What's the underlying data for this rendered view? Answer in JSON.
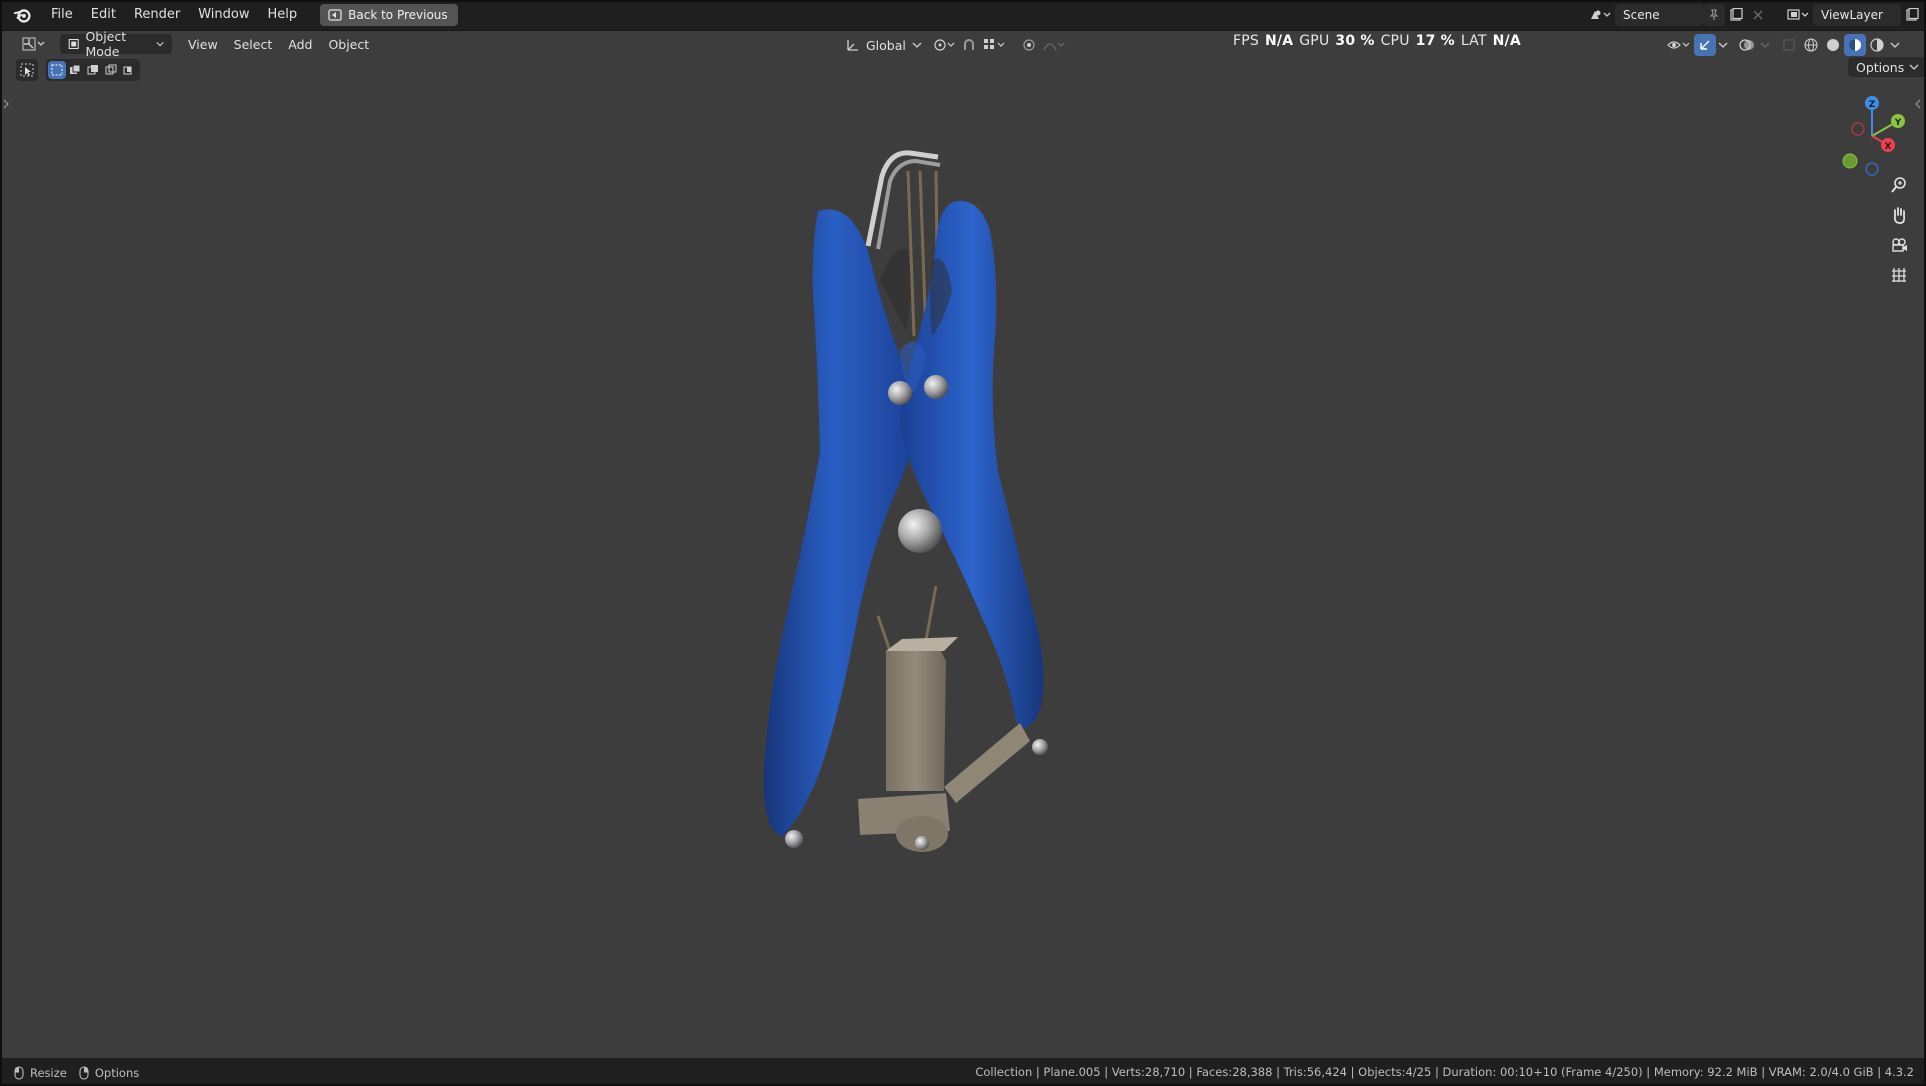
{
  "topbar": {
    "menu": [
      "File",
      "Edit",
      "Render",
      "Window",
      "Help"
    ],
    "back_button": "Back to Previous",
    "scene_name": "Scene",
    "view_layer": "ViewLayer"
  },
  "viewport_header": {
    "mode": "Object Mode",
    "menus": [
      "View",
      "Select",
      "Add",
      "Object"
    ],
    "orientation": "Global",
    "options": "Options"
  },
  "stats": {
    "fps_label": "FPS",
    "fps_value": "N/A",
    "gpu_label": "GPU",
    "gpu_value": "30 %",
    "cpu_label": "CPU",
    "cpu_value": "17 %",
    "lat_label": "LAT",
    "lat_value": "N/A"
  },
  "gizmo": {
    "z": "Z",
    "y": "Y",
    "x": "X"
  },
  "statusbar": {
    "left_resize": "Resize",
    "left_options": "Options",
    "right": "Collection | Plane.005 | Verts:28,710 | Faces:28,388 | Tris:56,424 | Objects:4/25 | Duration: 00:10+10 (Frame 4/250) | Memory: 92.2 MiB | VRAM: 2.0/4.0 GiB | 4.3.2"
  },
  "colors": {
    "viewport_bg": "#3d3d3d",
    "handle_blue": "#1f4fb0",
    "metal": "#8a8072",
    "accent_blue": "#4772b3",
    "axis_x": "#e8434f",
    "axis_y": "#8bc53f",
    "axis_z": "#3d8fe6"
  }
}
